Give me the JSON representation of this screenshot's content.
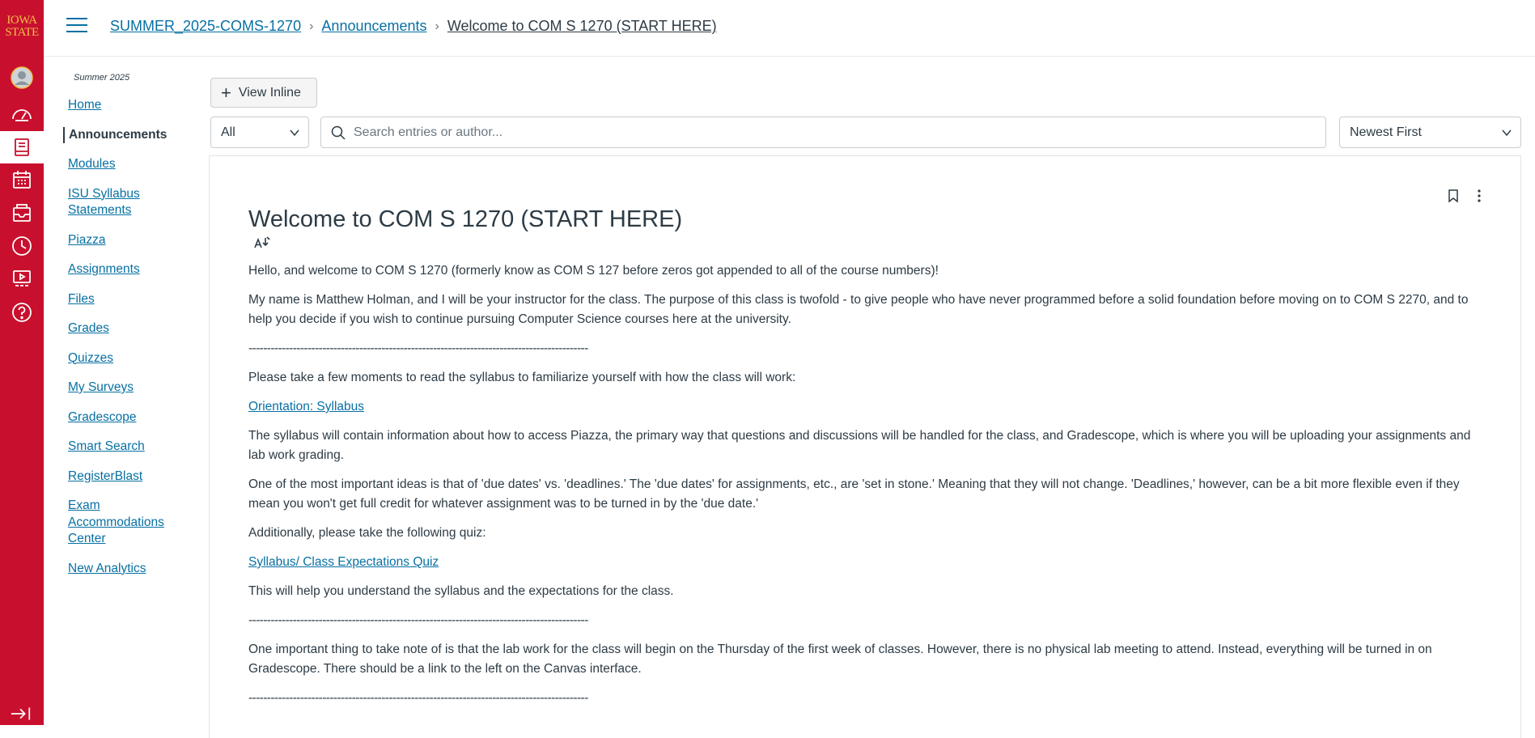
{
  "global_nav": {
    "logo_line1": "IOWA",
    "logo_line2": "STATE",
    "items": [
      {
        "name": "account-icon"
      },
      {
        "name": "dashboard-icon"
      },
      {
        "name": "courses-icon"
      },
      {
        "name": "calendar-icon"
      },
      {
        "name": "inbox-icon"
      },
      {
        "name": "history-icon"
      },
      {
        "name": "studio-icon"
      },
      {
        "name": "help-icon"
      }
    ],
    "accent": "#c8102e",
    "logo_color": "#f1be48"
  },
  "breadcrumb": {
    "items": [
      "SUMMER_2025-COMS-1270",
      "Announcements"
    ],
    "current": "Welcome to COM S 1270 (START HERE)"
  },
  "course_nav": {
    "term": "Summer 2025",
    "items": [
      "Home",
      "Announcements",
      "Modules",
      "ISU Syllabus Statements",
      "Piazza",
      "Assignments",
      "Files",
      "Grades",
      "Quizzes",
      "My Surveys",
      "Gradescope",
      "Smart Search",
      "RegisterBlast",
      "Exam Accommodations Center",
      "New Analytics"
    ],
    "active": "Announcements"
  },
  "toolbar": {
    "view_inline_label": "View Inline",
    "filter_value": "All",
    "search_placeholder": "Search entries or author...",
    "sort_value": "Newest First"
  },
  "post": {
    "title": "Welcome to COM S 1270 (START HERE)",
    "p1": "Hello, and welcome to COM S 1270 (formerly know as COM S 127 before zeros got appended to all of the course numbers)!",
    "p2": "My name is Matthew Holman, and I will be your instructor for the class. The purpose of this class is twofold - to give people who have never programmed before a solid foundation before moving on to COM S 2270, and to help you decide if you wish to continue pursuing Computer Science courses here at the university.",
    "divider": "--------------------------------------------------------------------------------------------",
    "p3": "Please take a few moments to read the syllabus to familiarize yourself with how the class will work:",
    "link1": "Orientation: Syllabus",
    "p4": "The syllabus will contain information about how to access Piazza, the primary way that questions and discussions will be handled for the class, and Gradescope, which is where you will be uploading your assignments and lab work grading.",
    "p5": "One of the most important ideas is that of 'due dates' vs. 'deadlines.' The 'due dates' for assignments, etc., are 'set in stone.' Meaning that they will not change. 'Deadlines,' however, can be a bit more flexible even if they mean you won't get full credit for whatever assignment was to be turned in by the 'due date.'",
    "p6": "Additionally, please take the following quiz:",
    "link2": "Syllabus/ Class Expectations Quiz",
    "p7": "This will help you understand the syllabus and the expectations for the class.",
    "p8": "One important thing to take note of is that the lab work for the class will begin on the Thursday of the first week of classes. However, there is no physical lab meeting to attend. Instead, everything will be turned in on Gradescope. There should be a link to the left on the Canvas interface."
  }
}
